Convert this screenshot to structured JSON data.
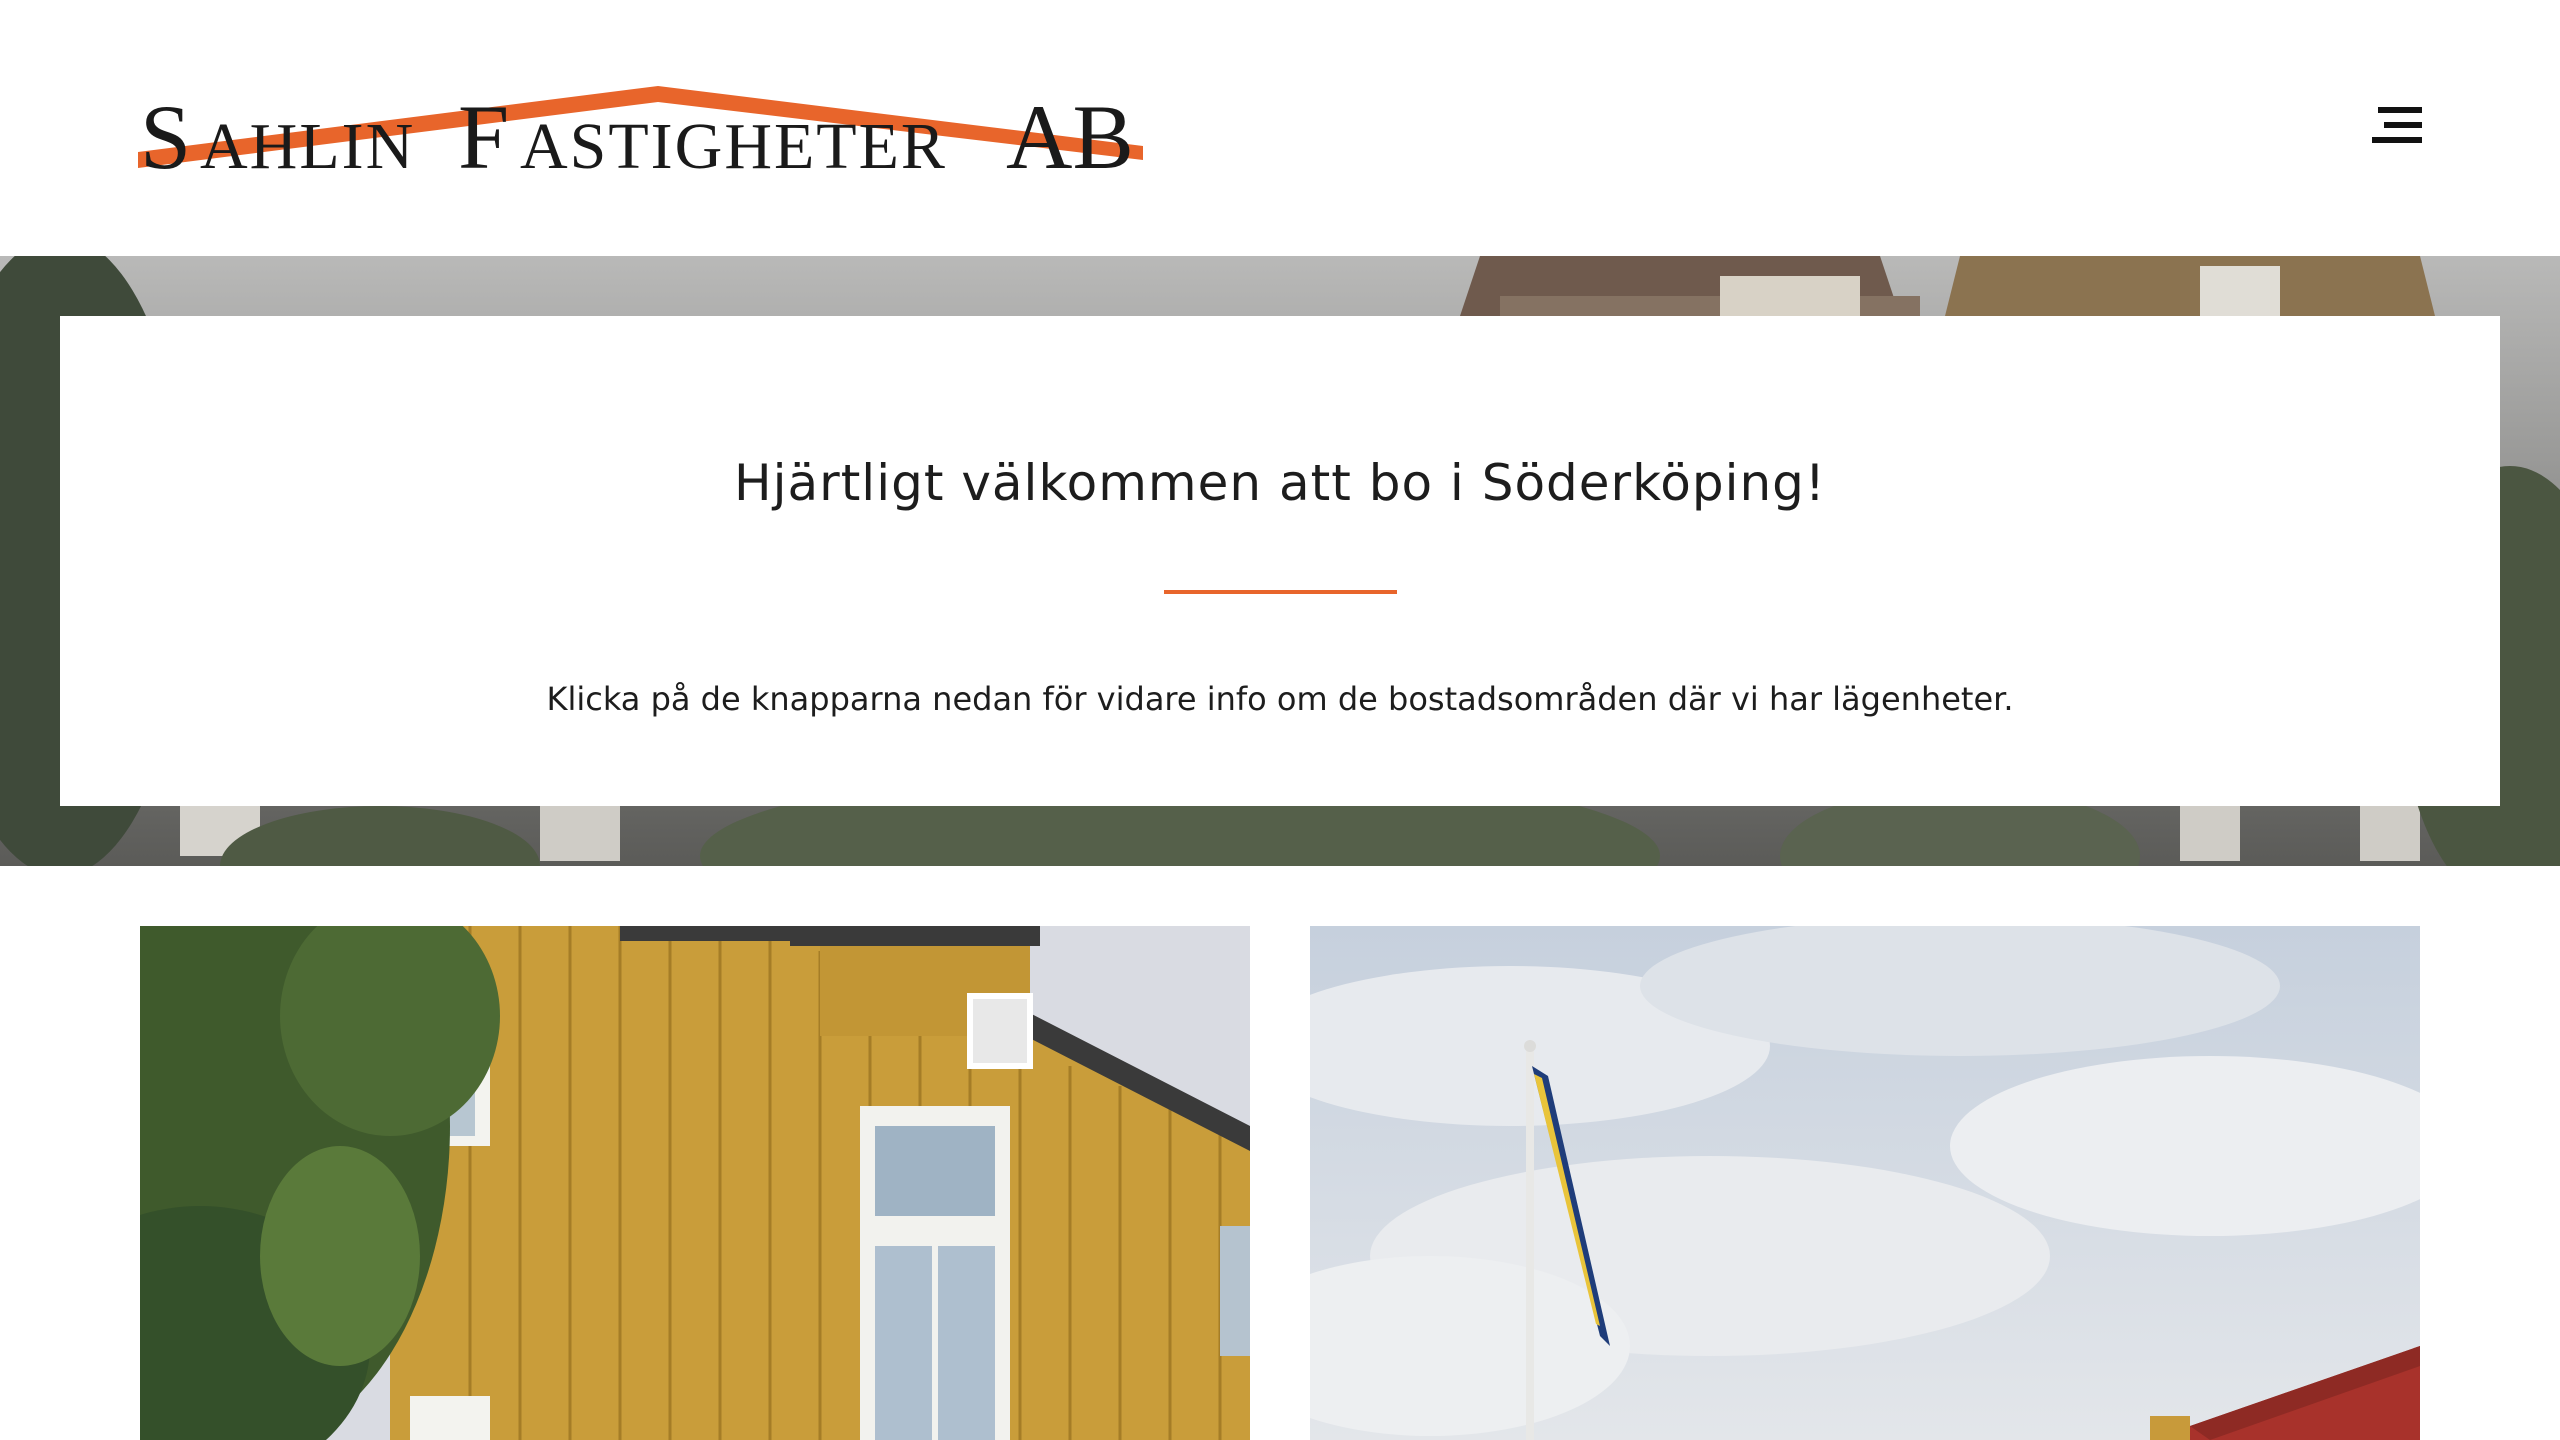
{
  "header": {
    "logo_text": "SAHLIN FASTIGHETER AB",
    "logo_color": "#1a1a1a",
    "logo_accent": "#e8652b",
    "menu_icon": "hamburger-menu-icon"
  },
  "hero": {
    "title": "Hjärtligt välkommen att bo i Söderköping!",
    "text": "Klicka på de knapparna nedan för vidare info om de bostadsområden där vi har lägenheter.",
    "divider_color": "#e8652b"
  },
  "colors": {
    "accent": "#e8652b",
    "text": "#1d1d1d",
    "background": "#ffffff"
  }
}
